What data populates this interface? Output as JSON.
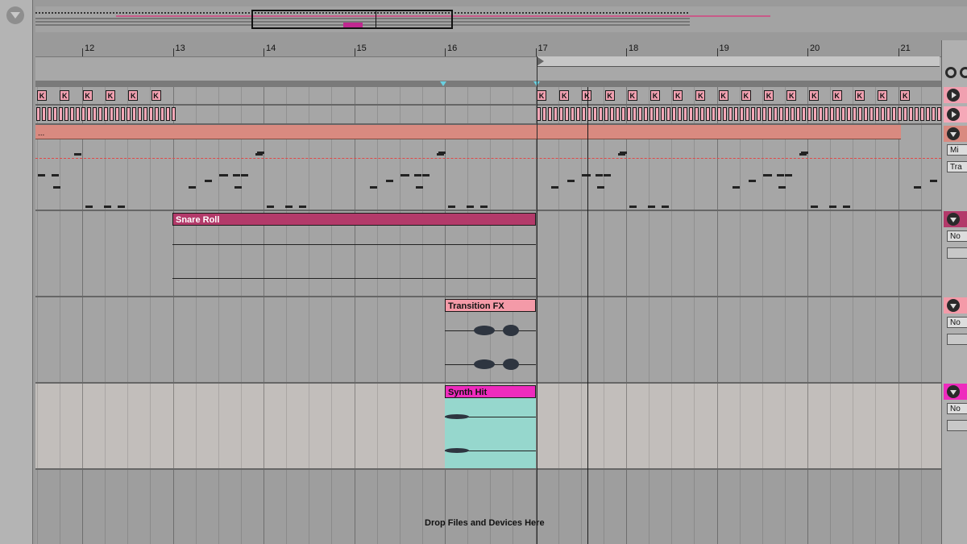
{
  "ruler": {
    "bars": [
      "12",
      "13",
      "14",
      "15",
      "16",
      "17",
      "18",
      "19",
      "20",
      "21"
    ]
  },
  "kick_label": "K",
  "midi_clip_label": "...",
  "clips": {
    "snare": {
      "name": "Snare Roll",
      "color": "#b33a6a"
    },
    "transition": {
      "name": "Transition FX",
      "color": "#f49aa8"
    },
    "synth": {
      "name": "Synth Hit",
      "color": "#ee2bbd",
      "body_color": "#96d7cd"
    }
  },
  "right_panel": {
    "track3_field1": "Mi",
    "track3_field2": "Tra",
    "track4_field": "No",
    "track5_field": "No",
    "track6_field": "No"
  },
  "drop_area": {
    "text": "Drop Files and Devices Here"
  },
  "colors": {
    "kick_track": "#f0a0b0",
    "hat_track": "#f5a8b8",
    "midi_track": "#d98a80",
    "loop_marker": "#6ad0e0"
  }
}
